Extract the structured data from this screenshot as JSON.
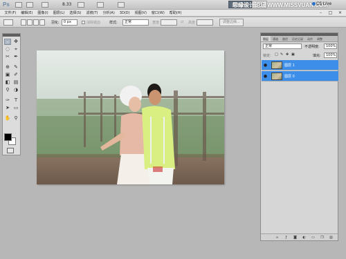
{
  "titlebar": {
    "logo": "Ps",
    "zoom": "8.33",
    "workspace_buttons": [
      "基本功能",
      "设计"
    ],
    "watermark": "思缘设计论坛 WWW.MISSVUAN.COM",
    "cs_live": "CS Live"
  },
  "menu": [
    "文件(F)",
    "编辑(E)",
    "图像(I)",
    "图层(L)",
    "选择(S)",
    "滤镜(T)",
    "分析(A)",
    "3D(D)",
    "视图(V)",
    "窗口(W)",
    "帮助(H)"
  ],
  "window_controls": [
    "–",
    "□",
    "×"
  ],
  "options": {
    "feather_label": "羽化:",
    "feather_value": "0 px",
    "antialias_label": "消除锯齿",
    "style_label": "样式:",
    "style_value": "正常",
    "width_label": "宽度",
    "height_label": "高度",
    "refine_edge": "调整边缘..."
  },
  "tools": [
    "⬚",
    "✥",
    "◌",
    "⌖",
    "✂",
    "✒",
    "⊕",
    "✎",
    "▣",
    "✐",
    "◧",
    "▤",
    "⚲",
    "◑",
    "✑",
    "T",
    "➤",
    "▭",
    "✋",
    "⚲"
  ],
  "layers_panel": {
    "tabs": [
      "图层",
      "通道",
      "路径",
      "历史记录",
      "动作",
      "调整"
    ],
    "blend_mode": "正常",
    "opacity_label": "不透明度:",
    "opacity_value": "100%",
    "lock_label": "锁定:",
    "fill_label": "填充:",
    "fill_value": "100%",
    "layers": [
      {
        "name": "图层 1",
        "visible": true,
        "selected": true
      },
      {
        "name": "图层 0",
        "visible": true,
        "selected": true
      }
    ],
    "footer_icons": [
      "link-icon",
      "fx-icon",
      "mask-icon",
      "adjustment-icon",
      "group-icon",
      "new-layer-icon",
      "trash-icon"
    ]
  }
}
